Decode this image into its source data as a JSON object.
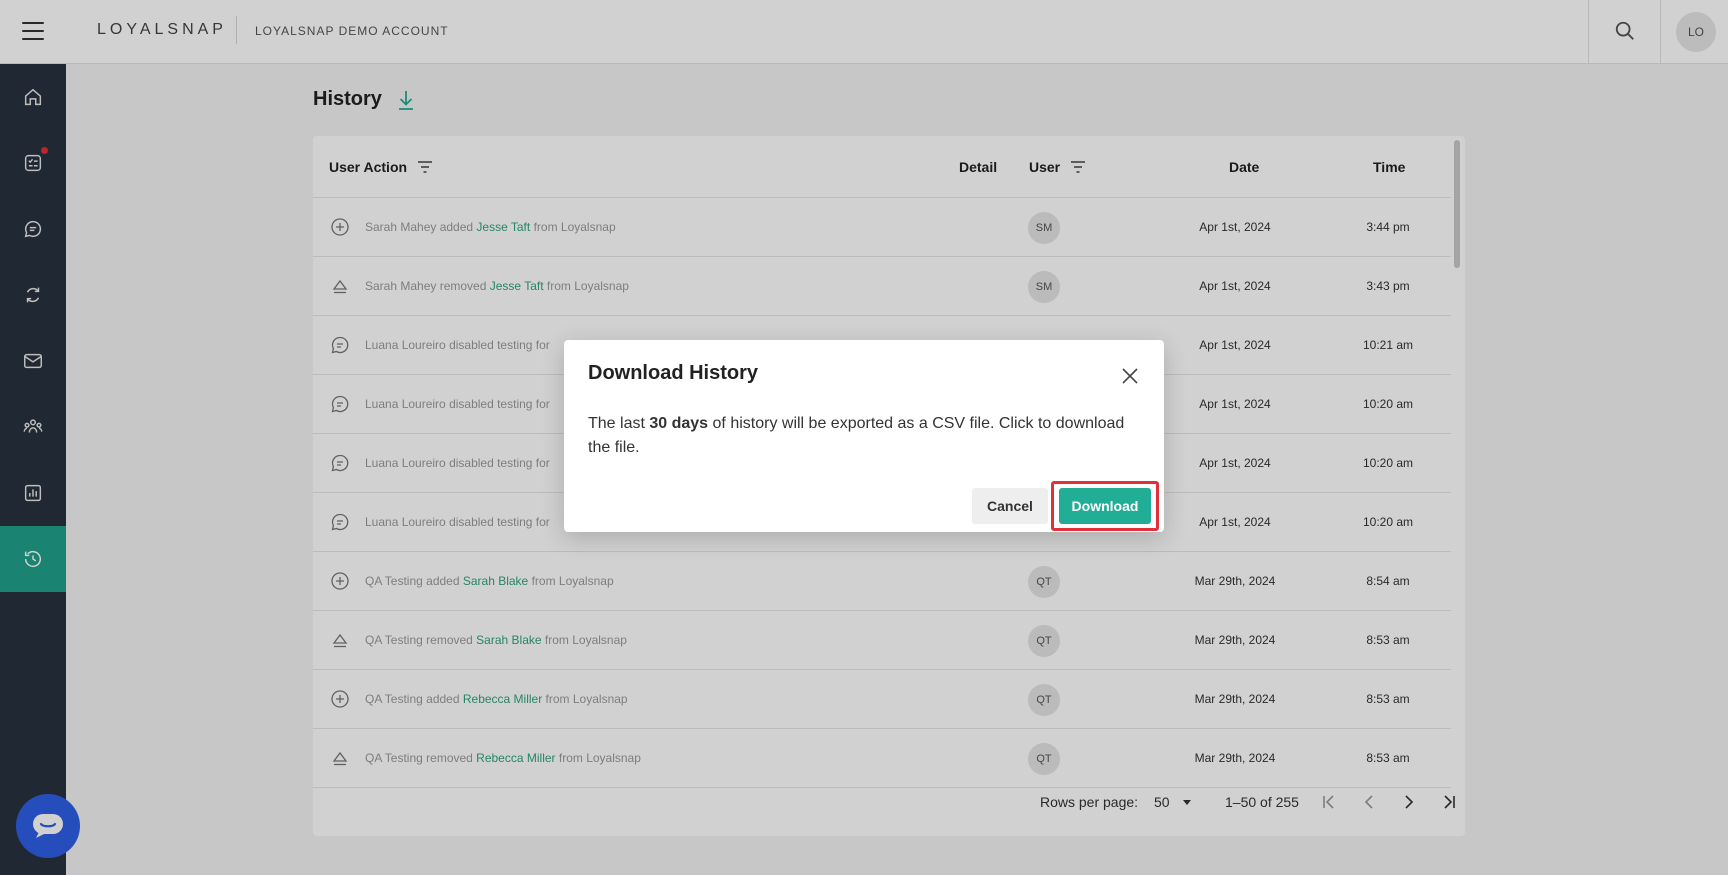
{
  "topbar": {
    "brand": "LOYALSNAP",
    "account": "LOYALSNAP DEMO ACCOUNT",
    "avatar": "LO",
    "icons": [
      "menu-icon",
      "search-icon"
    ]
  },
  "sidebar": {
    "items": [
      {
        "icon": "home-icon",
        "active": false
      },
      {
        "icon": "tasks-icon",
        "active": false,
        "notification": true
      },
      {
        "icon": "chat-icon",
        "active": false
      },
      {
        "icon": "refresh-icon",
        "active": false
      },
      {
        "icon": "mail-icon",
        "active": false
      },
      {
        "icon": "community-icon",
        "active": false
      },
      {
        "icon": "analytics-icon",
        "active": false
      },
      {
        "icon": "history-icon",
        "active": true
      }
    ],
    "accent": "#20a08c",
    "background": "#28313f"
  },
  "page": {
    "title": "History"
  },
  "table": {
    "headers": {
      "action": "User Action",
      "detail": "Detail",
      "user": "User",
      "date": "Date",
      "time": "Time"
    },
    "rows": [
      {
        "icon": "plus-circle-icon",
        "pre": "Sarah Mahey added ",
        "hl": "Jesse Taft",
        "post": " from Loyalsnap",
        "detail": "–",
        "user": "SM",
        "date": "Apr 1st, 2024",
        "time": "3:44 pm"
      },
      {
        "icon": "eject-icon",
        "pre": "Sarah Mahey removed ",
        "hl": "Jesse Taft",
        "post": " from Loyalsnap",
        "detail": "–",
        "user": "SM",
        "date": "Apr 1st, 2024",
        "time": "3:43 pm"
      },
      {
        "icon": "message-icon",
        "pre": "Luana Loureiro disabled testing for",
        "hl": "",
        "post": "",
        "detail": "",
        "user": "",
        "date": "Apr 1st, 2024",
        "time": "10:21 am"
      },
      {
        "icon": "message-icon",
        "pre": "Luana Loureiro disabled testing for",
        "hl": "",
        "post": "",
        "detail": "",
        "user": "",
        "date": "Apr 1st, 2024",
        "time": "10:20 am"
      },
      {
        "icon": "message-icon",
        "pre": "Luana Loureiro disabled testing for",
        "hl": "",
        "post": "",
        "detail": "",
        "user": "",
        "date": "Apr 1st, 2024",
        "time": "10:20 am"
      },
      {
        "icon": "message-icon",
        "pre": "Luana Loureiro disabled testing for",
        "hl": "",
        "post": "",
        "detail": "",
        "user": "",
        "date": "Apr 1st, 2024",
        "time": "10:20 am"
      },
      {
        "icon": "plus-circle-icon",
        "pre": "QA Testing added ",
        "hl": "Sarah Blake",
        "post": " from Loyalsnap",
        "detail": "–",
        "user": "QT",
        "date": "Mar 29th, 2024",
        "time": "8:54 am"
      },
      {
        "icon": "eject-icon",
        "pre": "QA Testing removed ",
        "hl": "Sarah Blake",
        "post": " from Loyalsnap",
        "detail": "–",
        "user": "QT",
        "date": "Mar 29th, 2024",
        "time": "8:53 am"
      },
      {
        "icon": "plus-circle-icon",
        "pre": "QA Testing added ",
        "hl": "Rebecca Miller",
        "post": " from Loyalsnap",
        "detail": "–",
        "user": "QT",
        "date": "Mar 29th, 2024",
        "time": "8:53 am"
      },
      {
        "icon": "eject-icon",
        "pre": "QA Testing removed ",
        "hl": "Rebecca Miller",
        "post": " from Loyalsnap",
        "detail": "–",
        "user": "QT",
        "date": "Mar 29th, 2024",
        "time": "8:53 am"
      }
    ]
  },
  "pagination": {
    "rows_per_page_label": "Rows per page:",
    "rows_per_page": "50",
    "range": "1–50 of 255"
  },
  "modal": {
    "title": "Download History",
    "body_pre": "The last ",
    "body_bold": "30 days",
    "body_post": " of history will be exported as a CSV file. Click to download the file.",
    "cancel": "Cancel",
    "download": "Download",
    "accent": "#22ad96",
    "highlight_color": "#e0303a"
  },
  "chat_launcher": {
    "icon": "chat-bubble-icon",
    "color": "#2f5fe6"
  }
}
